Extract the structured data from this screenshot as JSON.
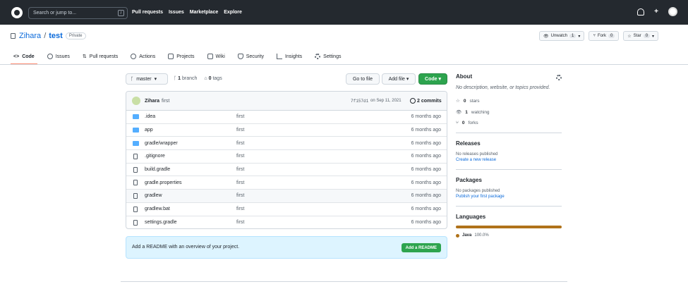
{
  "header": {
    "search_placeholder": "Search or jump to...",
    "search_key": "/",
    "nav": [
      "Pull requests",
      "Issues",
      "Marketplace",
      "Explore"
    ],
    "plus": "+"
  },
  "repo": {
    "owner": "Zihara",
    "separator": "/",
    "name": "test",
    "visibility": "Private",
    "watch_label": "Unwatch",
    "watch_count": "1",
    "fork_label": "Fork",
    "fork_count": "0",
    "star_label": "Star",
    "star_count": "0"
  },
  "tabs": [
    "Code",
    "Issues",
    "Pull requests",
    "Actions",
    "Projects",
    "Wiki",
    "Security",
    "Insights",
    "Settings"
  ],
  "branch": {
    "name": "master",
    "branch_count": "1",
    "branch_label": "branch",
    "tags_count": "0",
    "tags_label": "tags"
  },
  "buttons": {
    "go_to_file": "Go to file",
    "add_file": "Add file",
    "code": "Code"
  },
  "commit": {
    "author": "Zihara",
    "message": "first",
    "hash": "7f157d1",
    "date": "on Sep 11, 2021",
    "count": "2 commits"
  },
  "files": [
    {
      "name": ".idea",
      "type": "folder",
      "msg": "first",
      "time": "6 months ago"
    },
    {
      "name": "app",
      "type": "folder",
      "msg": "first",
      "time": "6 months ago"
    },
    {
      "name": "gradle/wrapper",
      "type": "folder",
      "msg": "first",
      "time": "6 months ago"
    },
    {
      "name": ".gitignore",
      "type": "file",
      "msg": "first",
      "time": "6 months ago"
    },
    {
      "name": "build.gradle",
      "type": "file",
      "msg": "first",
      "time": "6 months ago"
    },
    {
      "name": "gradle.properties",
      "type": "file",
      "msg": "first",
      "time": "6 months ago"
    },
    {
      "name": "gradlew",
      "type": "file",
      "msg": "first",
      "time": "6 months ago"
    },
    {
      "name": "gradlew.bat",
      "type": "file",
      "msg": "first",
      "time": "6 months ago"
    },
    {
      "name": "settings.gradle",
      "type": "file",
      "msg": "first",
      "time": "6 months ago"
    }
  ],
  "readme": {
    "text": "Add a README with an overview of your project.",
    "button": "Add a README"
  },
  "about": {
    "title": "About",
    "description": "No description, website, or topics provided.",
    "stars_count": "0",
    "stars_label": "stars",
    "watching_count": "1",
    "watching_label": "watching",
    "forks_count": "0",
    "forks_label": "forks"
  },
  "releases": {
    "title": "Releases",
    "text": "No releases published",
    "link": "Create a new release"
  },
  "packages": {
    "title": "Packages",
    "text": "No packages published",
    "link": "Publish your first package"
  },
  "languages": {
    "title": "Languages",
    "name": "Java",
    "percent": "100.0%",
    "color": "#b07219"
  }
}
